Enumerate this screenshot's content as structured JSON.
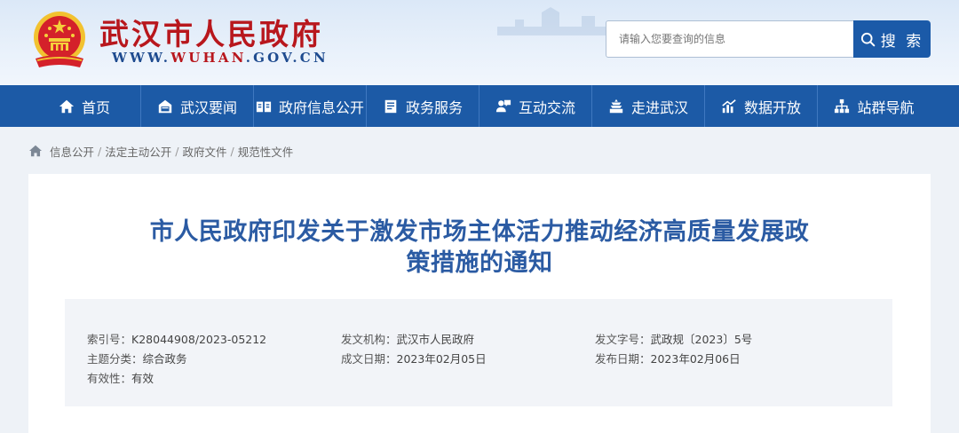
{
  "header": {
    "site_title": "武汉市人民政府",
    "site_domain_prefix": "WWW.",
    "site_domain_accent": "WUHAN",
    "site_domain_suffix": ".GOV.CN",
    "brand_color": "#b8171d",
    "accent_color": "#1c5aa6"
  },
  "search": {
    "placeholder": "请输入您要查询的信息",
    "button_label": "搜 索",
    "icon": "search-icon"
  },
  "nav": {
    "items": [
      {
        "label": "首页",
        "icon": "home-icon"
      },
      {
        "label": "武汉要闻",
        "icon": "news-icon"
      },
      {
        "label": "政府信息公开",
        "icon": "info-book-icon"
      },
      {
        "label": "政务服务",
        "icon": "service-icon"
      },
      {
        "label": "互动交流",
        "icon": "interaction-icon"
      },
      {
        "label": "走进武汉",
        "icon": "building-icon"
      },
      {
        "label": "数据开放",
        "icon": "data-chart-icon"
      },
      {
        "label": "站群导航",
        "icon": "sitemap-icon"
      }
    ]
  },
  "breadcrumb": {
    "icon": "home-icon",
    "items": [
      "信息公开",
      "法定主动公开",
      "政府文件",
      "规范性文件"
    ],
    "separator": "/"
  },
  "article": {
    "title_line1": "市人民政府印发关于激发市场主体活力推动经济高质量发展政",
    "title_line2": "策措施的通知",
    "meta": {
      "index_key": "索引号：",
      "index_val": "K28044908/2023-05212",
      "issuer_key": "发文机构：",
      "issuer_val": "武汉市人民政府",
      "docno_key": "发文字号：",
      "docno_val": "武政规〔2023〕5号",
      "topic_key": "主题分类：",
      "topic_val": "综合政务",
      "created_key": "成文日期：",
      "created_val": "2023年02月05日",
      "published_key": "发布日期：",
      "published_val": "2023年02月06日",
      "validity_key": "有效性：",
      "validity_val": "有效"
    }
  }
}
